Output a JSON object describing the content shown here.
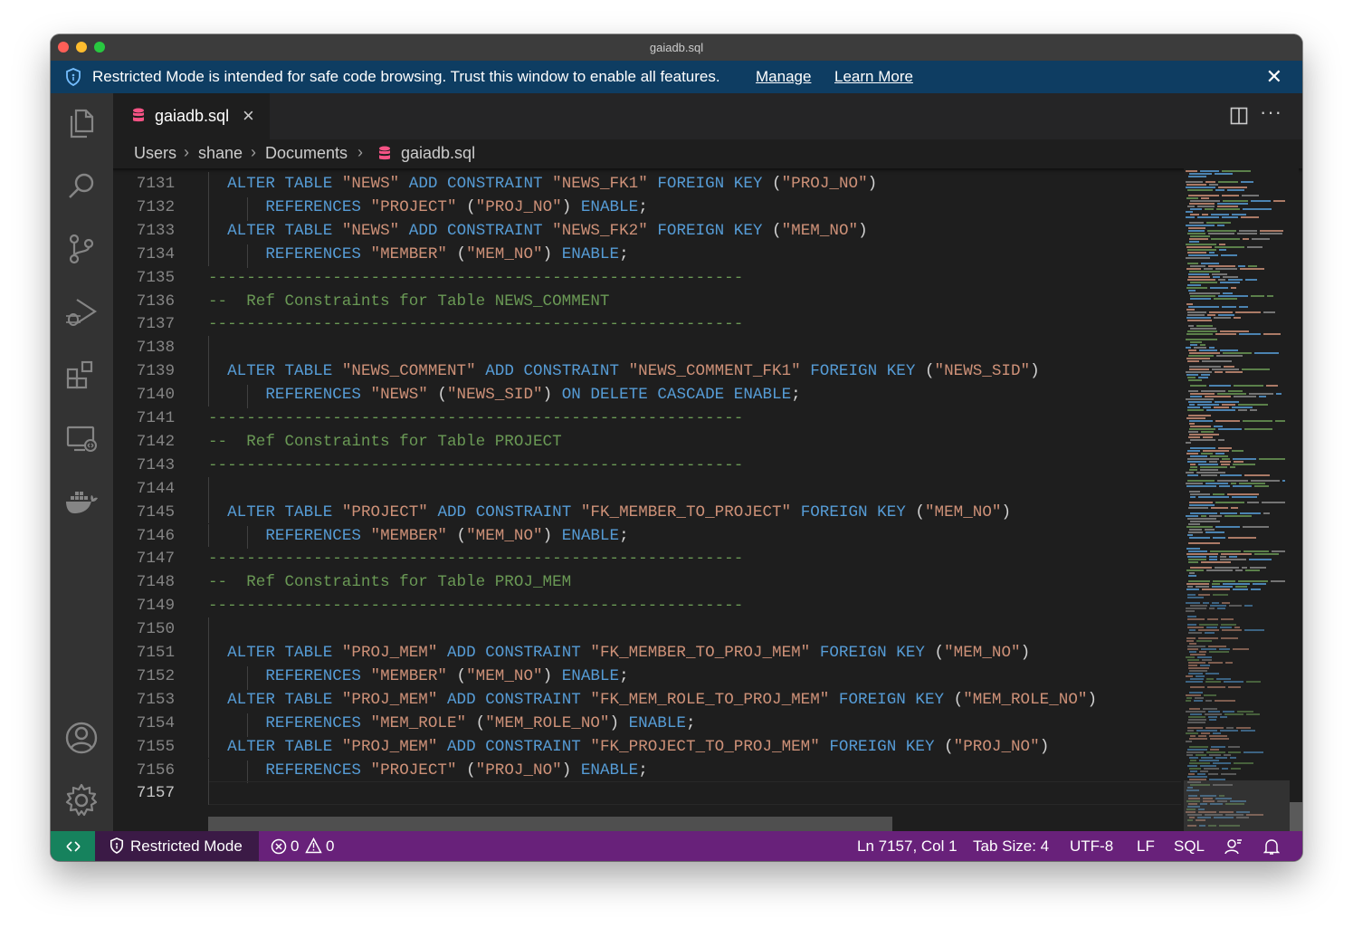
{
  "window": {
    "title": "gaiadb.sql"
  },
  "banner": {
    "message": "Restricted Mode is intended for safe code browsing. Trust this window to enable all features.",
    "manage": "Manage",
    "learn_more": "Learn More"
  },
  "activity_bar": {
    "items": [
      "explorer",
      "search",
      "source-control",
      "run-and-debug",
      "extensions",
      "remote-explorer",
      "docker"
    ],
    "bottom": [
      "accounts",
      "manage-settings"
    ]
  },
  "tab": {
    "label": "gaiadb.sql",
    "close": "×"
  },
  "breadcrumb": [
    "Users",
    "shane",
    "Documents",
    "gaiadb.sql"
  ],
  "editor": {
    "lines": [
      {
        "n": "7131",
        "text": "  ALTER TABLE \"NEWS\" ADD CONSTRAINT \"NEWS_FK1\" FOREIGN KEY (\"PROJ_NO\")"
      },
      {
        "n": "7132",
        "text": "      REFERENCES \"PROJECT\" (\"PROJ_NO\") ENABLE;"
      },
      {
        "n": "7133",
        "text": "  ALTER TABLE \"NEWS\" ADD CONSTRAINT \"NEWS_FK2\" FOREIGN KEY (\"MEM_NO\")"
      },
      {
        "n": "7134",
        "text": "      REFERENCES \"MEMBER\" (\"MEM_NO\") ENABLE;"
      },
      {
        "n": "7135",
        "text": "--------------------------------------------------------"
      },
      {
        "n": "7136",
        "text": "--  Ref Constraints for Table NEWS_COMMENT"
      },
      {
        "n": "7137",
        "text": "--------------------------------------------------------"
      },
      {
        "n": "7138",
        "text": ""
      },
      {
        "n": "7139",
        "text": "  ALTER TABLE \"NEWS_COMMENT\" ADD CONSTRAINT \"NEWS_COMMENT_FK1\" FOREIGN KEY (\"NEWS_SID\")"
      },
      {
        "n": "7140",
        "text": "      REFERENCES \"NEWS\" (\"NEWS_SID\") ON DELETE CASCADE ENABLE;"
      },
      {
        "n": "7141",
        "text": "--------------------------------------------------------"
      },
      {
        "n": "7142",
        "text": "--  Ref Constraints for Table PROJECT"
      },
      {
        "n": "7143",
        "text": "--------------------------------------------------------"
      },
      {
        "n": "7144",
        "text": ""
      },
      {
        "n": "7145",
        "text": "  ALTER TABLE \"PROJECT\" ADD CONSTRAINT \"FK_MEMBER_TO_PROJECT\" FOREIGN KEY (\"MEM_NO\")"
      },
      {
        "n": "7146",
        "text": "      REFERENCES \"MEMBER\" (\"MEM_NO\") ENABLE;"
      },
      {
        "n": "7147",
        "text": "--------------------------------------------------------"
      },
      {
        "n": "7148",
        "text": "--  Ref Constraints for Table PROJ_MEM"
      },
      {
        "n": "7149",
        "text": "--------------------------------------------------------"
      },
      {
        "n": "7150",
        "text": ""
      },
      {
        "n": "7151",
        "text": "  ALTER TABLE \"PROJ_MEM\" ADD CONSTRAINT \"FK_MEMBER_TO_PROJ_MEM\" FOREIGN KEY (\"MEM_NO\")"
      },
      {
        "n": "7152",
        "text": "      REFERENCES \"MEMBER\" (\"MEM_NO\") ENABLE;"
      },
      {
        "n": "7153",
        "text": "  ALTER TABLE \"PROJ_MEM\" ADD CONSTRAINT \"FK_MEM_ROLE_TO_PROJ_MEM\" FOREIGN KEY (\"MEM_ROLE_NO\")"
      },
      {
        "n": "7154",
        "text": "      REFERENCES \"MEM_ROLE\" (\"MEM_ROLE_NO\") ENABLE;"
      },
      {
        "n": "7155",
        "text": "  ALTER TABLE \"PROJ_MEM\" ADD CONSTRAINT \"FK_PROJECT_TO_PROJ_MEM\" FOREIGN KEY (\"PROJ_NO\")"
      },
      {
        "n": "7156",
        "text": "      REFERENCES \"PROJECT\" (\"PROJ_NO\") ENABLE;"
      },
      {
        "n": "7157",
        "text": ""
      }
    ],
    "active_line": "7157"
  },
  "status_bar": {
    "restricted_mode": "Restricted Mode",
    "errors": "0",
    "warnings": "0",
    "cursor": "Ln 7157, Col 1",
    "tab_size": "Tab Size: 4",
    "encoding": "UTF-8",
    "eol": "LF",
    "language": "SQL"
  },
  "colors": {
    "keyword": "#569cd6",
    "string": "#ce9178",
    "comment": "#6a9955",
    "status_bar": "#68217a",
    "banner": "#0e3d62",
    "remote": "#16825d"
  }
}
